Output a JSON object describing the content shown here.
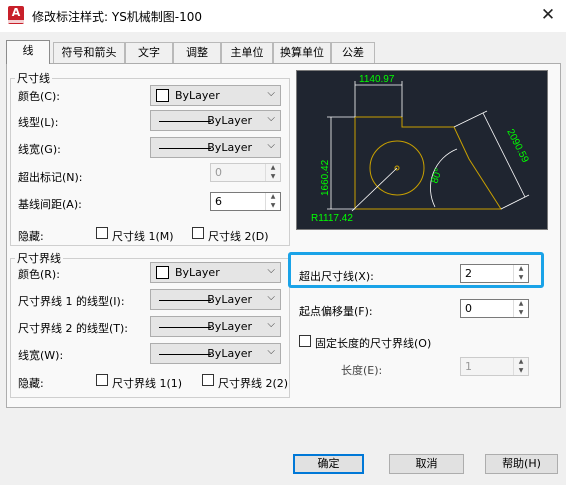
{
  "window": {
    "title": "修改标注样式: YS机械制图-100",
    "app_icon_letter": "A"
  },
  "tabs": [
    {
      "label": "线",
      "active": true
    },
    {
      "label": "符号和箭头"
    },
    {
      "label": "文字"
    },
    {
      "label": "调整"
    },
    {
      "label": "主单位"
    },
    {
      "label": "换算单位"
    },
    {
      "label": "公差"
    }
  ],
  "dim_lines": {
    "legend": "尺寸线",
    "color": {
      "label": "颜色(C):",
      "value": "ByLayer"
    },
    "linetype": {
      "label": "线型(L):",
      "value": "ByLayer"
    },
    "lineweight": {
      "label": "线宽(G):",
      "value": "ByLayer"
    },
    "extend_ticks": {
      "label": "超出标记(N):",
      "value": "0"
    },
    "baseline_spacing": {
      "label": "基线间距(A):",
      "value": "6"
    },
    "suppress": {
      "label": "隐藏:",
      "opt1": "尺寸线 1(M)",
      "opt2": "尺寸线 2(D)"
    }
  },
  "ext_lines": {
    "legend": "尺寸界线",
    "color": {
      "label": "颜色(R):",
      "value": "ByLayer"
    },
    "linetype1": {
      "label": "尺寸界线 1 的线型(I):",
      "value": "ByLayer"
    },
    "linetype2": {
      "label": "尺寸界线 2 的线型(T):",
      "value": "ByLayer"
    },
    "lineweight": {
      "label": "线宽(W):",
      "value": "ByLayer"
    },
    "suppress": {
      "label": "隐藏:",
      "opt1": "尺寸界线 1(1)",
      "opt2": "尺寸界线 2(2)"
    }
  },
  "right": {
    "extend_beyond": {
      "label": "超出尺寸线(X):",
      "value": "2"
    },
    "offset_origin": {
      "label": "起点偏移量(F):",
      "value": "0"
    },
    "fixed_length": {
      "label": "固定长度的尺寸界线(O)"
    },
    "length": {
      "label": "长度(E):",
      "value": "1"
    }
  },
  "preview": {
    "dim_top": "1140.97",
    "dim_left": "1660.42",
    "dim_right": "2090.59",
    "dim_angle": "80°",
    "dim_radius": "R1117.42",
    "colors": {
      "geometry": "#c8a000",
      "dims": "#00ff00",
      "background": "#1f2530"
    }
  },
  "buttons": {
    "ok": "确定",
    "cancel": "取消",
    "help": "帮助(H)"
  }
}
